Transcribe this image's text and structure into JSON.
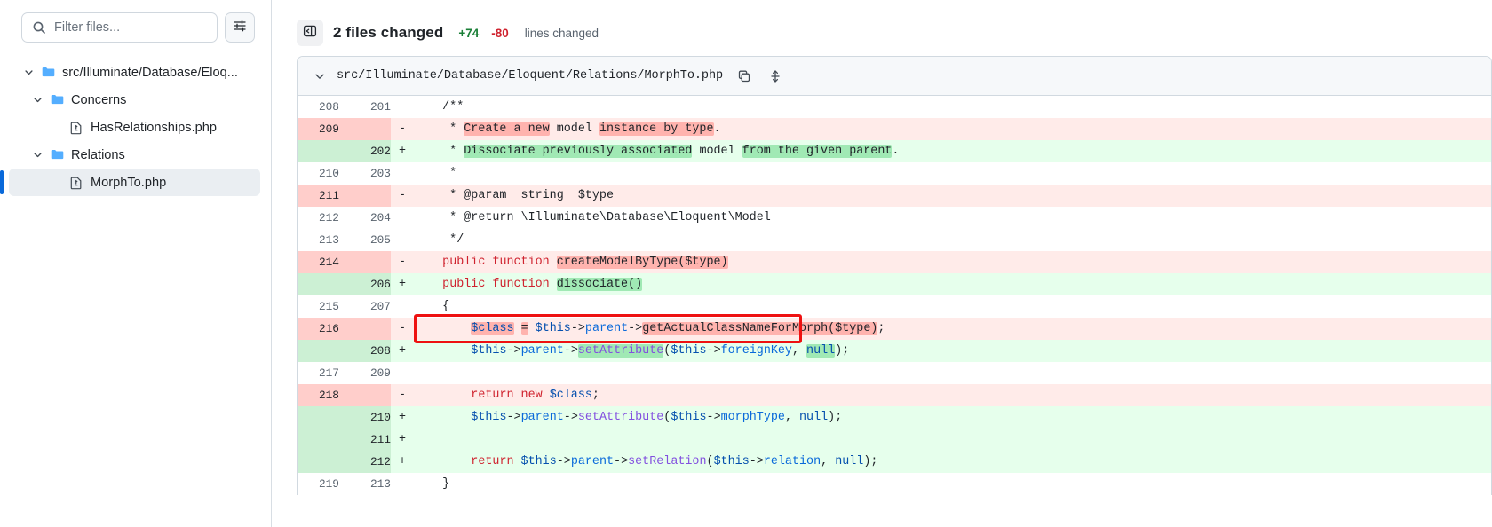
{
  "sidebar": {
    "filter": {
      "placeholder": "Filter files...",
      "value": ""
    },
    "filter_settings_icon": "sliders-icon",
    "search_icon": "search-icon",
    "tree": [
      {
        "label": "src/Illuminate/Database/Eloq...",
        "type": "folder",
        "indent": 0,
        "expanded": true,
        "selected": false
      },
      {
        "label": "Concerns",
        "type": "folder",
        "indent": 1,
        "expanded": true,
        "selected": false
      },
      {
        "label": "HasRelationships.php",
        "type": "file",
        "indent": 2,
        "expanded": null,
        "selected": false
      },
      {
        "label": "Relations",
        "type": "folder",
        "indent": 1,
        "expanded": true,
        "selected": false
      },
      {
        "label": "MorphTo.php",
        "type": "file",
        "indent": 2,
        "expanded": null,
        "selected": true
      }
    ]
  },
  "header": {
    "collapse_icon": "sidebar-collapse-icon",
    "files_changed": "2 files changed",
    "additions": "+74",
    "deletions": "-80",
    "lines_changed_label": "lines changed"
  },
  "file": {
    "chevron_icon": "chevron-down-icon",
    "path": "src/Illuminate/Database/Eloquent/Relations/MorphTo.php",
    "copy_icon": "copy-icon",
    "expand_icon": "expand-vertical-icon"
  },
  "annotation": {
    "color": "#ee1111",
    "target_line": "216"
  },
  "diff": {
    "rows": [
      {
        "old": "208",
        "new": "201",
        "mark": "",
        "type": "ctx",
        "tokens": [
          {
            "t": "    /**",
            "c": "cm"
          }
        ]
      },
      {
        "old": "209",
        "new": "",
        "mark": "-",
        "type": "del",
        "tokens": [
          {
            "t": "     * ",
            "c": "cm"
          },
          {
            "t": "Create a new",
            "c": "cm",
            "hl": "wd"
          },
          {
            "t": " model ",
            "c": "cm"
          },
          {
            "t": "instance by type",
            "c": "cm",
            "hl": "wd"
          },
          {
            "t": ".",
            "c": "cm"
          }
        ]
      },
      {
        "old": "",
        "new": "202",
        "mark": "+",
        "type": "add",
        "tokens": [
          {
            "t": "     * ",
            "c": "cm"
          },
          {
            "t": "Dissociate previously associated",
            "c": "cm",
            "hl": "wa"
          },
          {
            "t": " model ",
            "c": "cm"
          },
          {
            "t": "from the given parent",
            "c": "cm",
            "hl": "wa"
          },
          {
            "t": ".",
            "c": "cm"
          }
        ]
      },
      {
        "old": "210",
        "new": "203",
        "mark": "",
        "type": "ctx",
        "tokens": [
          {
            "t": "     *",
            "c": "cm"
          }
        ]
      },
      {
        "old": "211",
        "new": "",
        "mark": "-",
        "type": "del",
        "tokens": [
          {
            "t": "     * @param  string  $type",
            "c": "cm"
          }
        ]
      },
      {
        "old": "212",
        "new": "204",
        "mark": "",
        "type": "ctx",
        "tokens": [
          {
            "t": "     * @return \\Illuminate\\Database\\Eloquent\\Model",
            "c": "cm"
          }
        ]
      },
      {
        "old": "213",
        "new": "205",
        "mark": "",
        "type": "ctx",
        "tokens": [
          {
            "t": "     */",
            "c": "cm"
          }
        ]
      },
      {
        "old": "214",
        "new": "",
        "mark": "-",
        "type": "del",
        "tokens": [
          {
            "t": "    ",
            "c": "cm"
          },
          {
            "t": "public function ",
            "c": "kw"
          },
          {
            "t": "createModelByType($type)",
            "c": "cm",
            "hl": "wd"
          }
        ]
      },
      {
        "old": "",
        "new": "206",
        "mark": "+",
        "type": "add",
        "tokens": [
          {
            "t": "    ",
            "c": "cm"
          },
          {
            "t": "public function ",
            "c": "kw"
          },
          {
            "t": "dissociate()",
            "c": "cm",
            "hl": "wa"
          }
        ]
      },
      {
        "old": "215",
        "new": "207",
        "mark": "",
        "type": "ctx",
        "tokens": [
          {
            "t": "    {",
            "c": "cm"
          }
        ]
      },
      {
        "old": "216",
        "new": "",
        "mark": "-",
        "type": "del",
        "tokens": [
          {
            "t": "        ",
            "c": "cm"
          },
          {
            "t": "$class",
            "c": "var",
            "hl": "wd"
          },
          {
            "t": " ",
            "c": "cm"
          },
          {
            "t": "=",
            "c": "cm",
            "hl": "wd"
          },
          {
            "t": " ",
            "c": "cm"
          },
          {
            "t": "$this",
            "c": "var"
          },
          {
            "t": "->",
            "c": "cm"
          },
          {
            "t": "parent",
            "c": "prop"
          },
          {
            "t": "->",
            "c": "cm"
          },
          {
            "t": "getActualClassNameForMorph($type)",
            "c": "cm",
            "hl": "wd"
          },
          {
            "t": ";",
            "c": "cm"
          }
        ]
      },
      {
        "old": "",
        "new": "208",
        "mark": "+",
        "type": "add",
        "tokens": [
          {
            "t": "        ",
            "c": "cm"
          },
          {
            "t": "$this",
            "c": "var"
          },
          {
            "t": "->",
            "c": "cm"
          },
          {
            "t": "parent",
            "c": "prop"
          },
          {
            "t": "->",
            "c": "cm"
          },
          {
            "t": "setAttribute",
            "c": "fn",
            "hl": "wa"
          },
          {
            "t": "(",
            "c": "cm"
          },
          {
            "t": "$this",
            "c": "var"
          },
          {
            "t": "->",
            "c": "cm"
          },
          {
            "t": "foreignKey",
            "c": "prop"
          },
          {
            "t": ", ",
            "c": "cm"
          },
          {
            "t": "null",
            "c": "var",
            "hl": "wa"
          },
          {
            "t": ");",
            "c": "cm"
          }
        ]
      },
      {
        "old": "217",
        "new": "209",
        "mark": "",
        "type": "ctx",
        "tokens": [
          {
            "t": "",
            "c": "cm"
          }
        ]
      },
      {
        "old": "218",
        "new": "",
        "mark": "-",
        "type": "del",
        "tokens": [
          {
            "t": "        ",
            "c": "cm"
          },
          {
            "t": "return new ",
            "c": "kw"
          },
          {
            "t": "$class",
            "c": "var"
          },
          {
            "t": ";",
            "c": "cm"
          }
        ]
      },
      {
        "old": "",
        "new": "210",
        "mark": "+",
        "type": "add",
        "tokens": [
          {
            "t": "        ",
            "c": "cm"
          },
          {
            "t": "$this",
            "c": "var"
          },
          {
            "t": "->",
            "c": "cm"
          },
          {
            "t": "parent",
            "c": "prop"
          },
          {
            "t": "->",
            "c": "cm"
          },
          {
            "t": "setAttribute",
            "c": "fn"
          },
          {
            "t": "(",
            "c": "cm"
          },
          {
            "t": "$this",
            "c": "var"
          },
          {
            "t": "->",
            "c": "cm"
          },
          {
            "t": "morphType",
            "c": "prop"
          },
          {
            "t": ", ",
            "c": "cm"
          },
          {
            "t": "null",
            "c": "var"
          },
          {
            "t": ");",
            "c": "cm"
          }
        ]
      },
      {
        "old": "",
        "new": "211",
        "mark": "+",
        "type": "add",
        "tokens": [
          {
            "t": "",
            "c": "cm"
          }
        ]
      },
      {
        "old": "",
        "new": "212",
        "mark": "+",
        "type": "add",
        "tokens": [
          {
            "t": "        ",
            "c": "cm"
          },
          {
            "t": "return ",
            "c": "kw"
          },
          {
            "t": "$this",
            "c": "var"
          },
          {
            "t": "->",
            "c": "cm"
          },
          {
            "t": "parent",
            "c": "prop"
          },
          {
            "t": "->",
            "c": "cm"
          },
          {
            "t": "setRelation",
            "c": "fn"
          },
          {
            "t": "(",
            "c": "cm"
          },
          {
            "t": "$this",
            "c": "var"
          },
          {
            "t": "->",
            "c": "cm"
          },
          {
            "t": "relation",
            "c": "prop"
          },
          {
            "t": ", ",
            "c": "cm"
          },
          {
            "t": "null",
            "c": "var"
          },
          {
            "t": ");",
            "c": "cm"
          }
        ]
      },
      {
        "old": "219",
        "new": "213",
        "mark": "",
        "type": "ctx",
        "tokens": [
          {
            "t": "    }",
            "c": "cm"
          }
        ]
      }
    ]
  }
}
